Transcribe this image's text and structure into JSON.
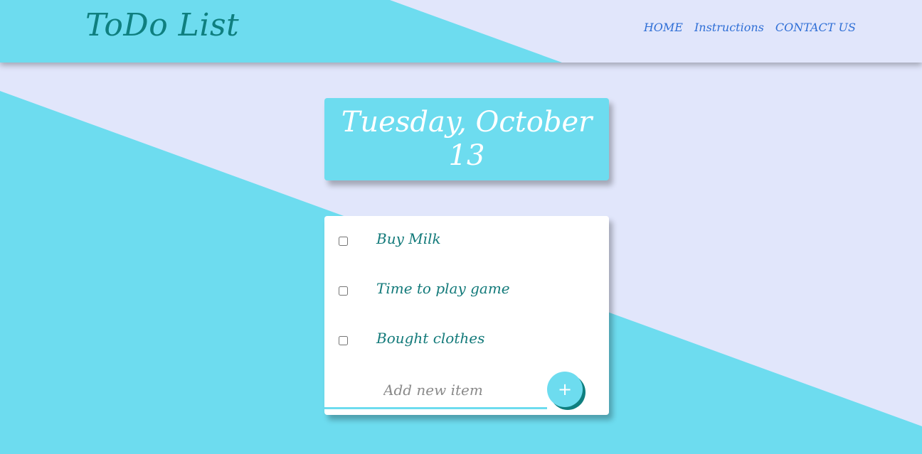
{
  "app": {
    "title": "ToDo List"
  },
  "nav": {
    "items": [
      {
        "label": "HOME"
      },
      {
        "label": "Instructions"
      },
      {
        "label": "CONTACT US"
      }
    ]
  },
  "date": {
    "heading": "Tuesday, October 13"
  },
  "todo": {
    "items": [
      {
        "label": "Buy Milk",
        "checked": false
      },
      {
        "label": "Time to play game",
        "checked": false
      },
      {
        "label": "Bought clothes",
        "checked": false
      }
    ],
    "new_item": {
      "value": "",
      "placeholder": "Add new item"
    },
    "add_button_label": "+"
  },
  "colors": {
    "accent": "#6ddcef",
    "background": "#e1e6fb",
    "teal_text": "#137a7a",
    "nav_link": "#2f6fd6"
  }
}
